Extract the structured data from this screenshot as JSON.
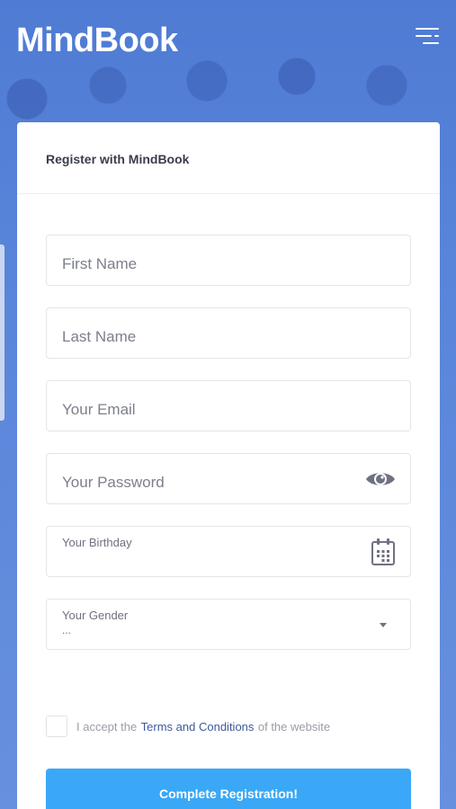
{
  "app": {
    "logo": "MindBook"
  },
  "card": {
    "title": "Register with MindBook"
  },
  "form": {
    "first_name": {
      "placeholder": "First Name"
    },
    "last_name": {
      "placeholder": "Last Name"
    },
    "email": {
      "placeholder": "Your Email"
    },
    "password": {
      "placeholder": "Your Password",
      "toggle_icon": "eye-icon"
    },
    "birthday": {
      "label": "Your Birthday",
      "icon": "calendar-icon"
    },
    "gender": {
      "label": "Your Gender",
      "value": "...",
      "icon": "caret-down-icon"
    }
  },
  "terms": {
    "prefix": "I accept the",
    "link": "Terms and Conditions",
    "suffix": "of the website"
  },
  "submit": {
    "label": "Complete Registration!"
  },
  "colors": {
    "background": "#5b86d8",
    "primary_button": "#3aa8f6",
    "link": "#3c5a9a",
    "icon": "#6e7180"
  }
}
